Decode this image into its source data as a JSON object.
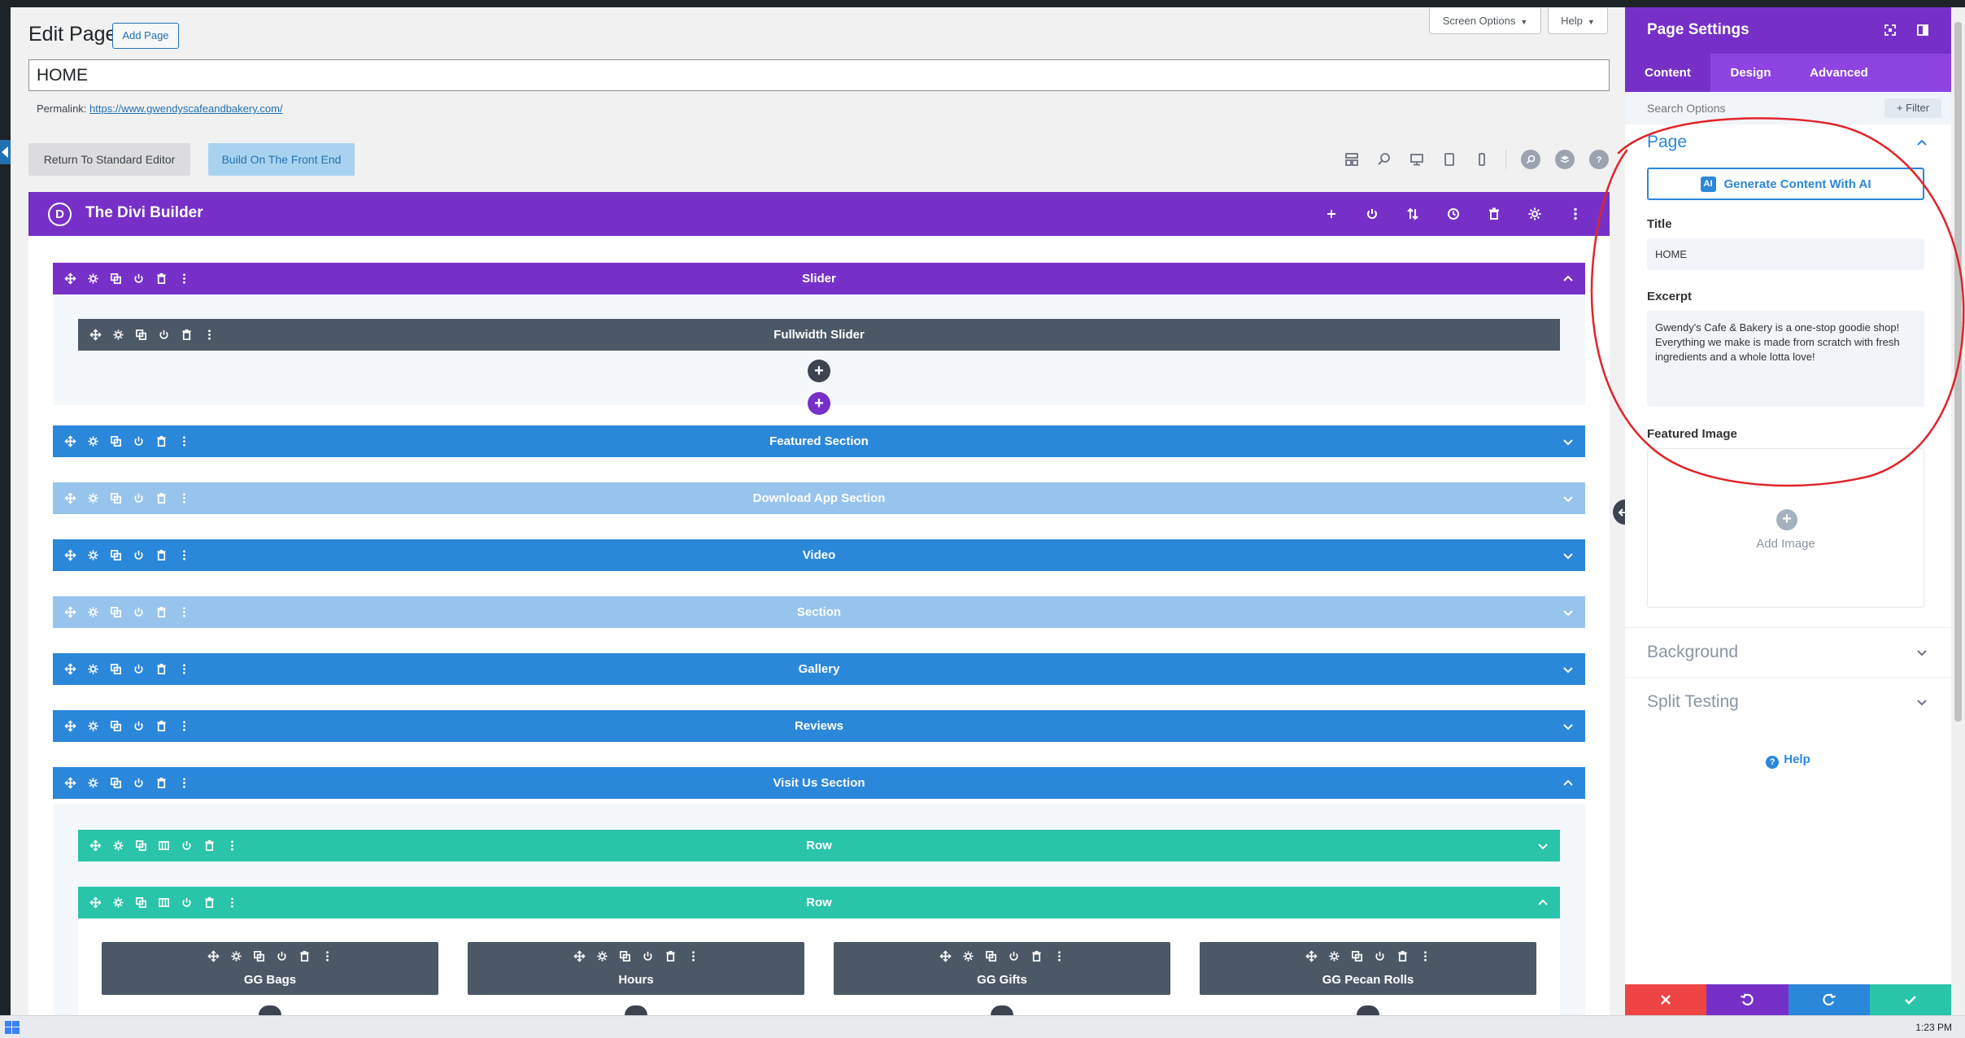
{
  "wp": {
    "page_heading": "Edit Page",
    "add_page": "Add Page",
    "screen_options": "Screen Options",
    "help": "Help",
    "title_value": "HOME",
    "permalink_label": "Permalink:",
    "permalink_url": "https://www.gwendyscafeandbakery.com/",
    "return_to_standard": "Return To Standard Editor",
    "build_front_end": "Build On The Front End"
  },
  "divi": {
    "logo_letter": "D",
    "title": "The Divi Builder"
  },
  "sections": [
    {
      "label": "Slider",
      "style": "purple",
      "expanded": true
    },
    {
      "label": "Featured Section",
      "style": "blue",
      "expanded": false
    },
    {
      "label": "Download App Section",
      "style": "light",
      "expanded": false
    },
    {
      "label": "Video",
      "style": "blue",
      "expanded": false
    },
    {
      "label": "Section",
      "style": "light",
      "expanded": false
    },
    {
      "label": "Gallery",
      "style": "blue",
      "expanded": false
    },
    {
      "label": "Reviews",
      "style": "blue",
      "expanded": false
    },
    {
      "label": "Visit Us Section",
      "style": "blue",
      "expanded": true
    }
  ],
  "slider_module": "Fullwidth Slider",
  "rows": [
    {
      "label": "Row",
      "expanded": false
    },
    {
      "label": "Row",
      "expanded": true
    }
  ],
  "modules": [
    "GG Bags",
    "Hours",
    "GG Gifts",
    "GG Pecan Rolls"
  ],
  "panel": {
    "title": "Page Settings",
    "tabs": [
      "Content",
      "Design",
      "Advanced"
    ],
    "active_tab": "Content",
    "search_placeholder": "Search Options",
    "filter": "+ Filter",
    "page_group": "Page",
    "ai_button": "Generate Content With AI",
    "ai_icon_text": "AI",
    "title_label": "Title",
    "title_value": "HOME",
    "excerpt_label": "Excerpt",
    "excerpt_value": "Gwendy's Cafe & Bakery is a one-stop goodie shop! Everything we make is made from scratch with fresh ingredients and a whole lotta love!",
    "featured_label": "Featured Image",
    "add_image": "Add Image",
    "background": "Background",
    "split_testing": "Split Testing",
    "help": "Help"
  },
  "colors": {
    "divi_purple": "#7630c8",
    "section_blue": "#2b87da",
    "disabled_blue": "#97c4ec",
    "row_teal": "#29c4a9",
    "module_dark": "#4c5866",
    "annotation_red": "#e0242a",
    "footer_red": "#ef4444",
    "footer_purple": "#7630c8",
    "footer_blue": "#2b87da",
    "footer_green": "#29c4a9"
  },
  "taskbar": {
    "clock": "1:23 PM"
  }
}
